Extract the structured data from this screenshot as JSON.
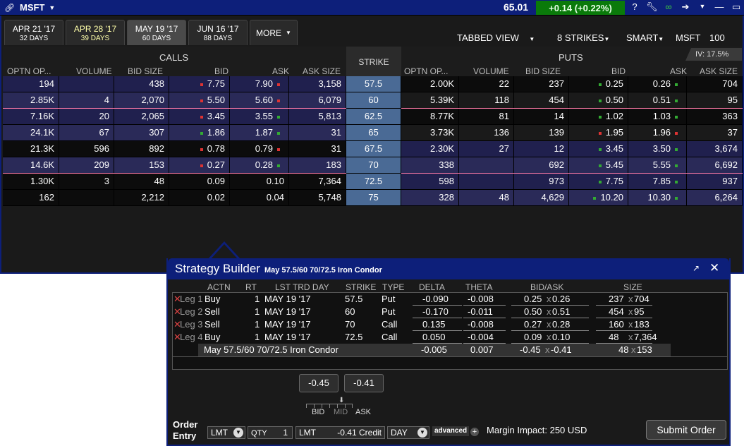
{
  "titlebar": {
    "symbol": "MSFT",
    "last_price": "65.01",
    "change": "+0.14 (+0.22%)",
    "icons": [
      "question-icon",
      "wrench-icon",
      "chain-link-icon",
      "pin-icon",
      "dropdown-icon",
      "minimize-icon",
      "maximize-icon",
      "close-icon"
    ]
  },
  "expirations": [
    {
      "label": "APR 21 '17",
      "days": "32 DAYS",
      "highlight": false
    },
    {
      "label": "APR 28 '17",
      "days": "39 DAYS",
      "highlight": true
    },
    {
      "label": "MAY 19 '17",
      "days": "60 DAYS",
      "active": true
    },
    {
      "label": "JUN 16 '17",
      "days": "88 DAYS"
    }
  ],
  "more_label": "MORE",
  "view": {
    "tabbed": "TABBED VIEW",
    "strikes": "8 STRIKES",
    "exchange": "SMART",
    "symbol": "MSFT",
    "qty": "100"
  },
  "iv": "IV: 17.5%",
  "calls_label": "CALLS",
  "puts_label": "PUTS",
  "strike_label": "STRIKE",
  "columns": {
    "calls": [
      "OPTN OP...",
      "VOLUME",
      "BID SIZE",
      "BID",
      "ASK",
      "ASK SIZE"
    ],
    "puts": [
      "OPTN OP...",
      "VOLUME",
      "BID SIZE",
      "BID",
      "ASK",
      "ASK SIZE"
    ]
  },
  "rows": [
    {
      "c_oi": "194",
      "c_vol": "",
      "c_bsz": "438",
      "c_bid": "7.75",
      "c_ask": "7.90",
      "c_asz": "3,158",
      "strike": "57.5",
      "p_oi": "2.00K",
      "p_vol": "22",
      "p_bsz": "237",
      "p_bid": "0.25",
      "p_ask": "0.26",
      "p_asz": "704"
    },
    {
      "c_oi": "2.85K",
      "c_vol": "4",
      "c_bsz": "2,070",
      "c_bid": "5.50",
      "c_ask": "5.60",
      "c_asz": "6,079",
      "strike": "60",
      "p_oi": "5.39K",
      "p_vol": "118",
      "p_bsz": "454",
      "p_bid": "0.50",
      "p_ask": "0.51",
      "p_asz": "95"
    },
    {
      "c_oi": "7.16K",
      "c_vol": "20",
      "c_bsz": "2,065",
      "c_bid": "3.45",
      "c_ask": "3.55",
      "c_asz": "5,813",
      "strike": "62.5",
      "p_oi": "8.77K",
      "p_vol": "81",
      "p_bsz": "14",
      "p_bid": "1.02",
      "p_ask": "1.03",
      "p_asz": "363"
    },
    {
      "c_oi": "24.1K",
      "c_vol": "67",
      "c_bsz": "307",
      "c_bid": "1.86",
      "c_ask": "1.87",
      "c_asz": "31",
      "strike": "65",
      "p_oi": "3.73K",
      "p_vol": "136",
      "p_bsz": "139",
      "p_bid": "1.95",
      "p_ask": "1.96",
      "p_asz": "37"
    },
    {
      "c_oi": "21.3K",
      "c_vol": "596",
      "c_bsz": "892",
      "c_bid": "0.78",
      "c_ask": "0.79",
      "c_asz": "31",
      "strike": "67.5",
      "p_oi": "2.30K",
      "p_vol": "27",
      "p_bsz": "12",
      "p_bid": "3.45",
      "p_ask": "3.50",
      "p_asz": "3,674"
    },
    {
      "c_oi": "14.6K",
      "c_vol": "209",
      "c_bsz": "153",
      "c_bid": "0.27",
      "c_ask": "0.28",
      "c_asz": "183",
      "strike": "70",
      "p_oi": "338",
      "p_vol": "",
      "p_bsz": "692",
      "p_bid": "5.45",
      "p_ask": "5.55",
      "p_asz": "6,692"
    },
    {
      "c_oi": "1.30K",
      "c_vol": "3",
      "c_bsz": "48",
      "c_bid": "0.09",
      "c_ask": "0.10",
      "c_asz": "7,364",
      "strike": "72.5",
      "p_oi": "598",
      "p_vol": "",
      "p_bsz": "973",
      "p_bid": "7.75",
      "p_ask": "7.85",
      "p_asz": "937"
    },
    {
      "c_oi": "162",
      "c_vol": "",
      "c_bsz": "2,212",
      "c_bid": "0.02",
      "c_ask": "0.04",
      "c_asz": "5,748",
      "strike": "75",
      "p_oi": "328",
      "p_vol": "48",
      "p_bsz": "4,629",
      "p_bid": "10.20",
      "p_ask": "10.30",
      "p_asz": "6,264"
    }
  ],
  "strategy": {
    "title": "Strategy Builder",
    "subtitle": "May 57.5/60 70/72.5 Iron Condor",
    "headers": [
      "ACTN",
      "RT",
      "LST TRD DAY",
      "STRIKE",
      "TYPE",
      "DELTA",
      "THETA",
      "BID/ASK",
      "SIZE"
    ],
    "legs": [
      {
        "leg": "Leg 1",
        "actn": "Buy",
        "rt": "1",
        "day": "MAY 19 '17",
        "strike": "57.5",
        "type": "Put",
        "delta": "-0.090",
        "theta": "-0.008",
        "bid": "0.25",
        "ask": "0.26",
        "bsz": "237",
        "asz": "704"
      },
      {
        "leg": "Leg 2",
        "actn": "Sell",
        "rt": "1",
        "day": "MAY 19 '17",
        "strike": "60",
        "type": "Put",
        "delta": "-0.170",
        "theta": "-0.011",
        "bid": "0.50",
        "ask": "0.51",
        "bsz": "454",
        "asz": "95"
      },
      {
        "leg": "Leg 3",
        "actn": "Sell",
        "rt": "1",
        "day": "MAY 19 '17",
        "strike": "70",
        "type": "Call",
        "delta": "0.135",
        "theta": "-0.008",
        "bid": "0.27",
        "ask": "0.28",
        "bsz": "160",
        "asz": "183"
      },
      {
        "leg": "Leg 4",
        "actn": "Buy",
        "rt": "1",
        "day": "MAY 19 '17",
        "strike": "72.5",
        "type": "Call",
        "delta": "0.050",
        "theta": "-0.004",
        "bid": "0.09",
        "ask": "0.10",
        "bsz": "48",
        "asz": "7,364"
      }
    ],
    "combo": {
      "name": "May 57.5/60 70/72.5 Iron Condor",
      "delta": "-0.005",
      "theta": "0.007",
      "bid": "-0.45",
      "ask": "-0.41",
      "bsz": "48",
      "asz": "153"
    },
    "bid_btn": "-0.45",
    "ask_btn": "-0.41",
    "scale_bid": "BID",
    "scale_mid": "MID",
    "scale_ask": "ASK",
    "order_entry_label_1": "Order",
    "order_entry_label_2": "Entry",
    "order_type": "LMT",
    "qty_label": "QTY",
    "qty_value": "1",
    "limit_label": "LMT",
    "limit_value": "-0.41 Credit",
    "tif": "DAY",
    "advanced": "advanced",
    "margin": "Margin Impact: 250 USD",
    "submit": "Submit Order"
  }
}
